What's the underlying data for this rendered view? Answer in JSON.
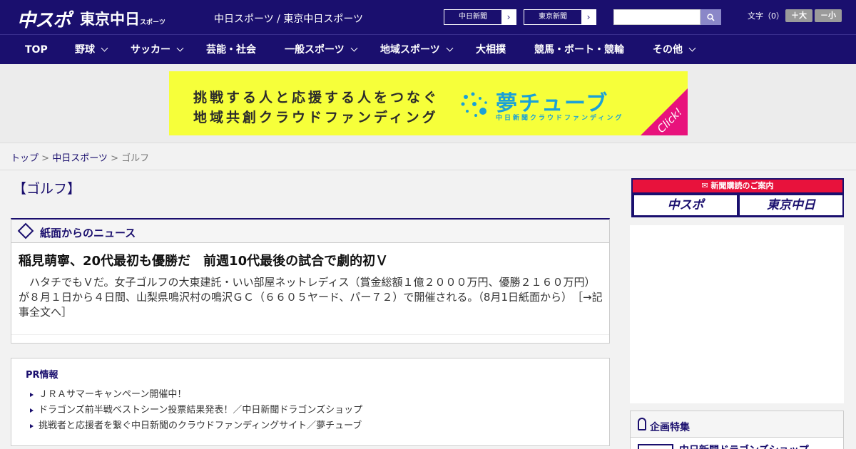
{
  "header": {
    "logo_chuspo": "中スポ",
    "logo_tokyo": "東京中日",
    "logo_tokyo_small": "スポーツ",
    "site_names": "中日スポーツ / 東京中日スポーツ",
    "paper_buttons": [
      "中日新聞",
      "東京新聞"
    ],
    "font_label": "文字（0）",
    "font_bigger": "＋大",
    "font_smaller": "－小"
  },
  "nav": {
    "items": [
      "TOP",
      "野球",
      "サッカー",
      "芸能・社会",
      "一般スポーツ",
      "地域スポーツ",
      "大相撲",
      "競馬・ボート・競輪",
      "その他"
    ]
  },
  "banner": {
    "line1": "挑戦する人と応援する人をつなぐ",
    "line2": "地域共創クラウドファンディング",
    "brand": "夢チューブ",
    "brand_sub": "中日新聞クラウドファンディング",
    "click": "Click!"
  },
  "breadcrumb": {
    "top": "トップ",
    "sep1": " > ",
    "site": "中日スポーツ",
    "sep2": " > ",
    "current": "ゴルフ"
  },
  "main": {
    "genre_title": "【ゴルフ】",
    "news_section_title": "紙面からのニュース",
    "headline": "稲見萌寧、20代最初も優勝だ　前週10代最後の試合で劇的初Ｖ",
    "body": "　ハタチでもＶだ。女子ゴルフの大東建託・いい部屋ネットレディス（賞金総額１億２０００万円、優勝２１６０万円）が８月１日から４日間、山梨県鳴沢村の鳴沢ＧＣ（６６０５ヤード、パー７２）で開催される。（8月1日紙面から）",
    "more_link": "［→記事全文へ］"
  },
  "pr": {
    "title": "PR情報",
    "items": [
      "ＪＲＡサマーキャンペーン開催中！",
      "ドラゴンズ前半戦ベストシーン投票結果発表！／中日新聞ドラゴンズショップ",
      "挑戦者と応援者を繋ぐ中日新聞のクラウドファンディングサイト／夢チューブ"
    ]
  },
  "sidebar": {
    "subscribe_title": "新聞購読のご案内",
    "subscribe_chuspo": "中スポ",
    "subscribe_tokyo": "東京中日",
    "special_title": "企画特集",
    "special_item": "中日新聞ドラゴンズショップ"
  }
}
